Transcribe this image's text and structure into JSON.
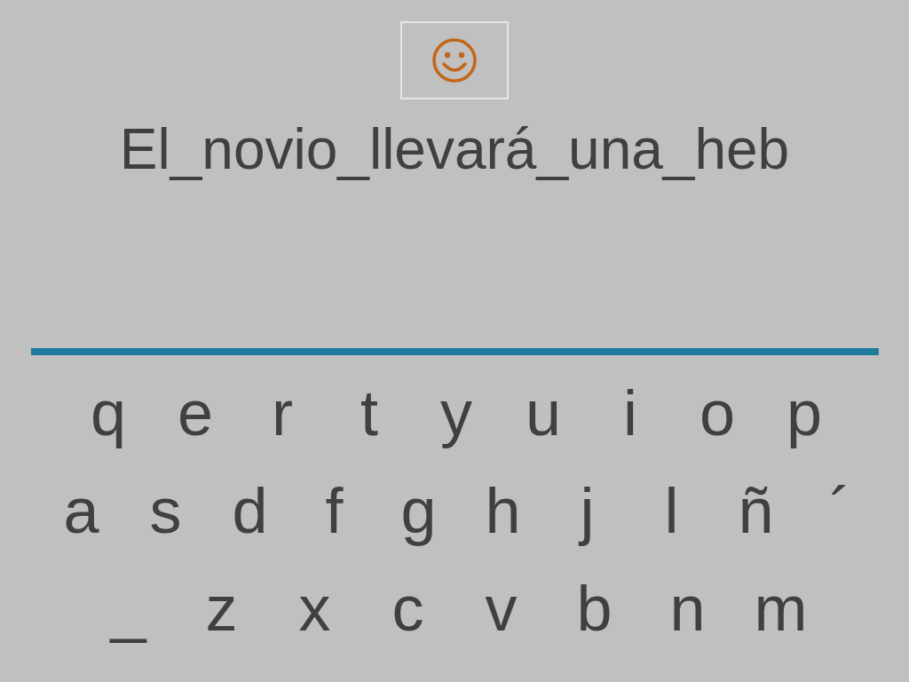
{
  "sentence": "El_novio_llevará_una_heb",
  "keyboard": {
    "rows": [
      {
        "keys": [
          "q",
          "e",
          "r",
          "t",
          "y",
          "u",
          "i",
          "o",
          "p"
        ]
      },
      {
        "keys": [
          "a",
          "s",
          "d",
          "f",
          "g",
          "h",
          "j",
          "l",
          "ñ",
          "´"
        ]
      },
      {
        "keys": [
          "_",
          "z",
          "x",
          "c",
          "v",
          "b",
          "n",
          "m"
        ]
      }
    ]
  }
}
